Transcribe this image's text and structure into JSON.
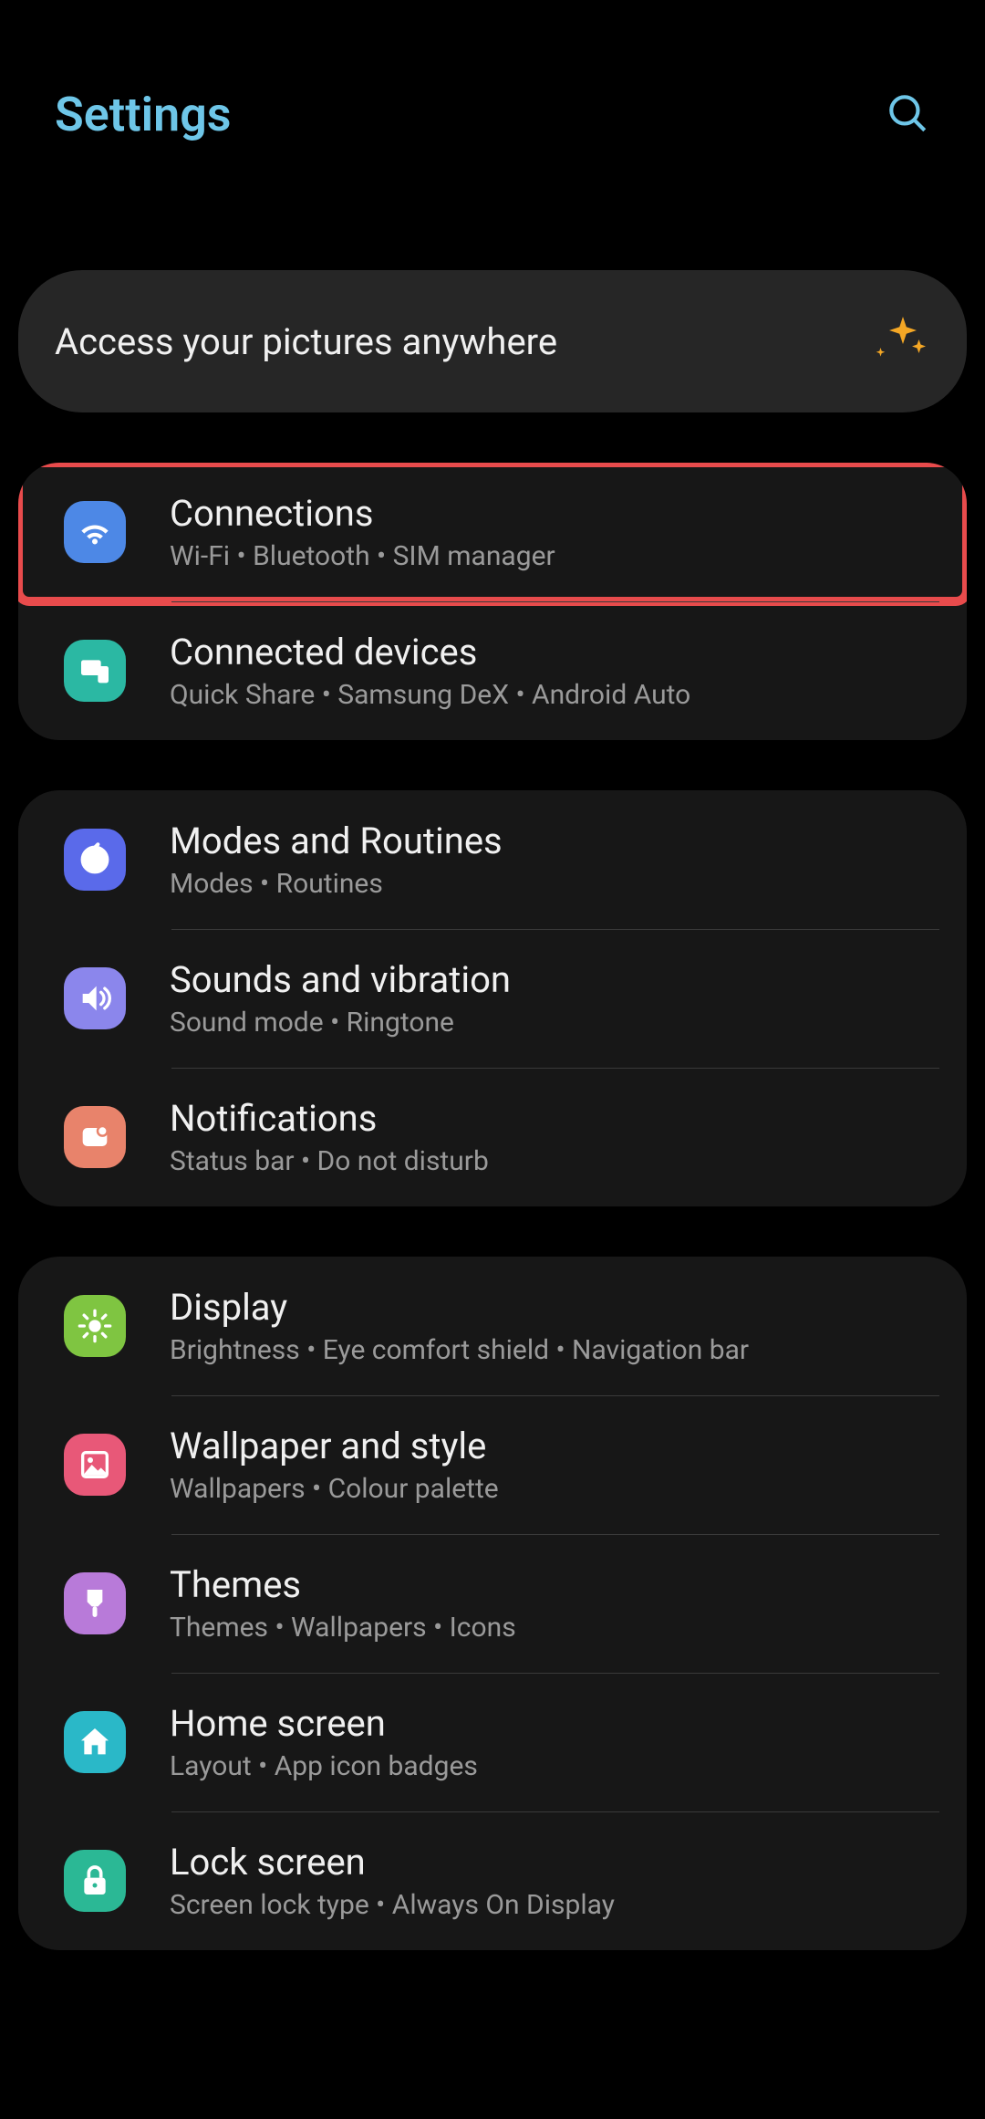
{
  "header": {
    "title": "Settings"
  },
  "banner": {
    "text": "Access your pictures anywhere"
  },
  "groups": [
    {
      "items": [
        {
          "title": "Connections",
          "sub": "Wi-Fi  •  Bluetooth  •  SIM manager",
          "icon": "wifi",
          "highlighted": true
        },
        {
          "title": "Connected devices",
          "sub": "Quick Share  •  Samsung DeX  •  Android Auto",
          "icon": "conn"
        }
      ]
    },
    {
      "items": [
        {
          "title": "Modes and Routines",
          "sub": "Modes  •  Routines",
          "icon": "modes"
        },
        {
          "title": "Sounds and vibration",
          "sub": "Sound mode  •  Ringtone",
          "icon": "sound"
        },
        {
          "title": "Notifications",
          "sub": "Status bar  •  Do not disturb",
          "icon": "notif"
        }
      ]
    },
    {
      "items": [
        {
          "title": "Display",
          "sub": "Brightness  •  Eye comfort shield  •  Navigation bar",
          "icon": "disp"
        },
        {
          "title": "Wallpaper and style",
          "sub": "Wallpapers  •  Colour palette",
          "icon": "wall"
        },
        {
          "title": "Themes",
          "sub": "Themes  •  Wallpapers  •  Icons",
          "icon": "theme"
        },
        {
          "title": "Home screen",
          "sub": "Layout  •  App icon badges",
          "icon": "home"
        },
        {
          "title": "Lock screen",
          "sub": "Screen lock type  •  Always On Display",
          "icon": "lock"
        }
      ]
    }
  ]
}
